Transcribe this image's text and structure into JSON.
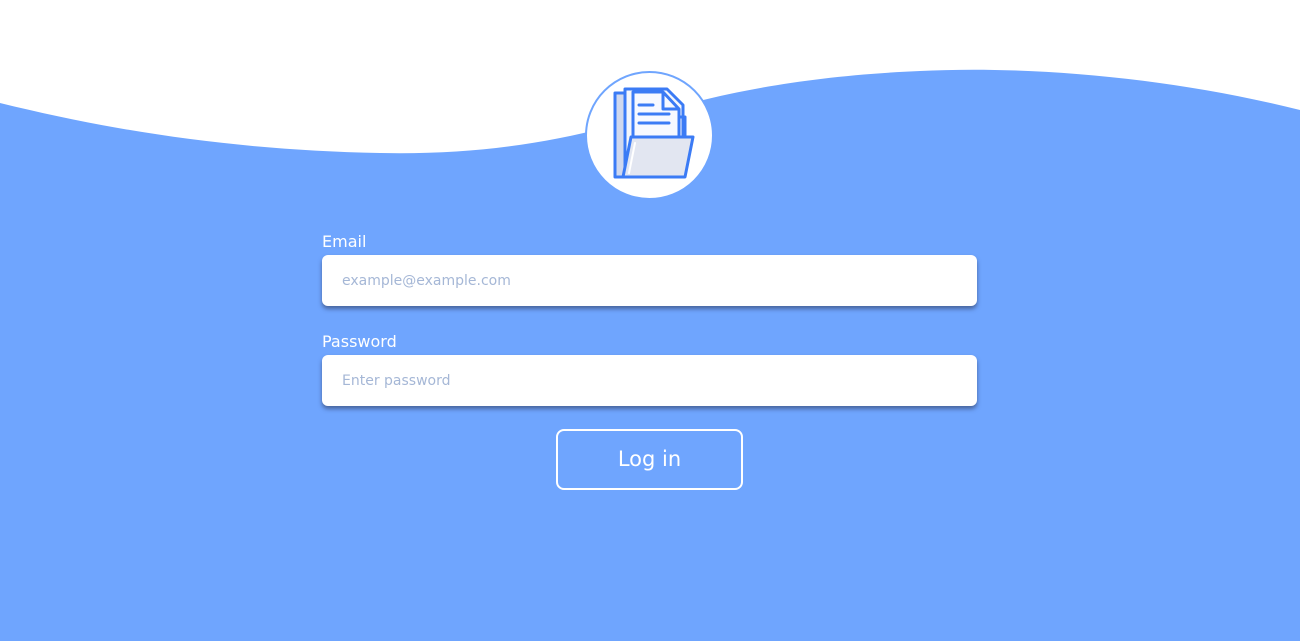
{
  "login": {
    "email_label": "Email",
    "email_placeholder": "example@example.com",
    "password_label": "Password",
    "password_placeholder": "Enter password",
    "submit_label": "Log in"
  },
  "logo": {
    "icon": "open-folder-document-icon"
  },
  "colors": {
    "background": "#6fa5fe",
    "wave_top": "#ffffff",
    "input_background": "#ffffff",
    "placeholder": "#a5b7d6",
    "icon_stroke": "#3b7bf5",
    "icon_fill": "#e2e6f1"
  }
}
